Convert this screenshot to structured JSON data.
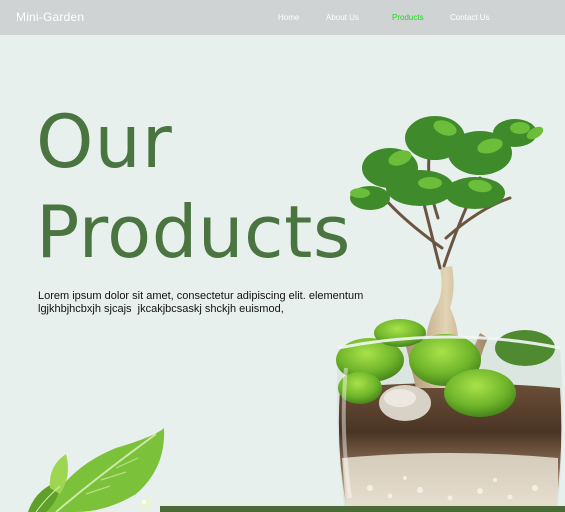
{
  "nav": {
    "brand": "Mini-Garden",
    "links": [
      "Home",
      "About Us",
      "Products",
      "Contact Us"
    ],
    "active": "Products"
  },
  "hero": {
    "title_line1": "Our",
    "title_line2": "Products",
    "description_line1": "Lorem ipsum dolor sit amet, consectetur adipiscing elit. elementum",
    "description_line2": "lgjkhbjhcbxjh sjcajs  jkcakjbcsaskj shckjh euismod,"
  },
  "colors": {
    "background": "#e8f0ee",
    "navbar": "#cfd3d3",
    "title": "#4a7440",
    "active_link": "#22d822",
    "bottom_bar": "#4a6b38"
  },
  "images": {
    "hero_plant": "bonsai-terrarium-image",
    "corner_leaves": "green-leaves-image"
  }
}
